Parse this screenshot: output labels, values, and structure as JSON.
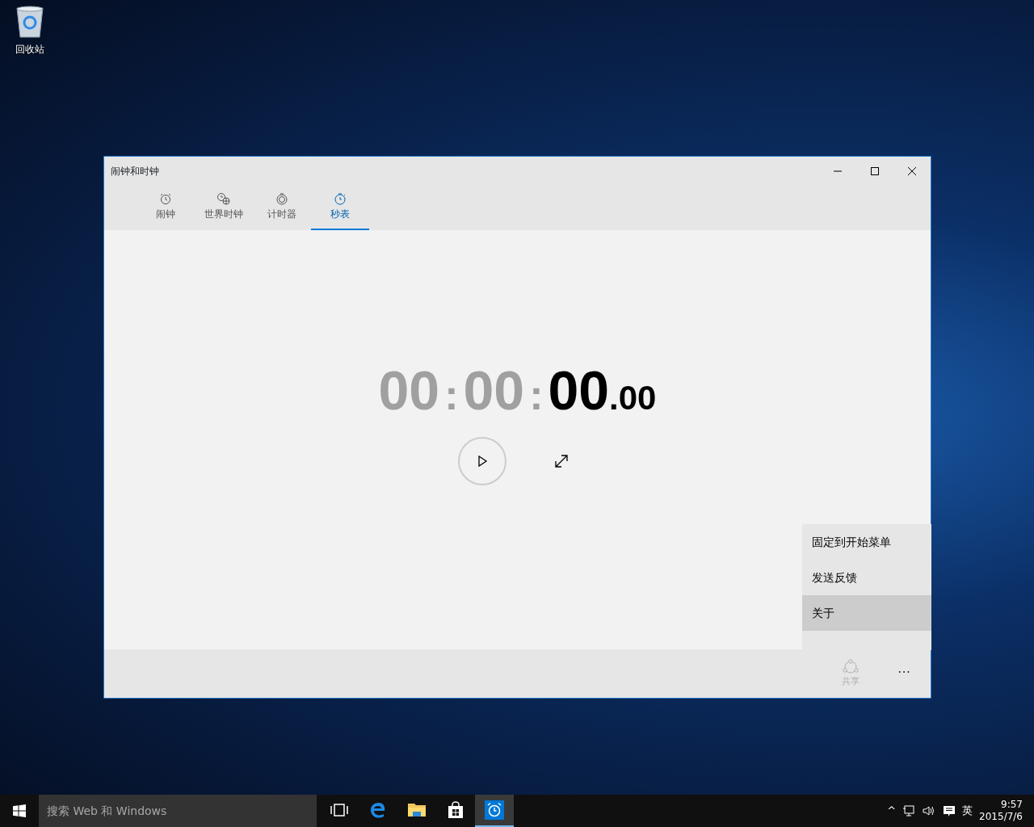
{
  "desktop_icons": [
    {
      "label": "回收站"
    }
  ],
  "window": {
    "title": "闹钟和时钟"
  },
  "tabs": [
    {
      "label": "闹钟",
      "selected": false
    },
    {
      "label": "世界时钟",
      "selected": false
    },
    {
      "label": "计时器",
      "selected": false
    },
    {
      "label": "秒表",
      "selected": true
    }
  ],
  "stopwatch": {
    "segments": [
      {
        "text": "00",
        "kind": "dim"
      },
      {
        "text": ":",
        "kind": "separator"
      },
      {
        "text": "00",
        "kind": "dim"
      },
      {
        "text": ":",
        "kind": "separator"
      },
      {
        "text": "00",
        "kind": "main"
      },
      {
        "text": ".",
        "kind": "fraction"
      },
      {
        "text": "00",
        "kind": "fraction"
      }
    ]
  },
  "menu": {
    "items": [
      {
        "label": "固定到开始菜单",
        "selected": false
      },
      {
        "label": "发送反馈",
        "selected": false
      },
      {
        "label": "关于",
        "selected": true
      }
    ]
  },
  "app_bar": {
    "share": {
      "label": "共享",
      "disabled": true
    },
    "more": "⋯"
  },
  "taskbar": {
    "search": {
      "placeholder": "搜索 Web 和 Windows"
    },
    "apps": [
      {
        "kind": "taskview",
        "selected": false
      },
      {
        "kind": "edge",
        "selected": false
      },
      {
        "kind": "explorer",
        "selected": false
      },
      {
        "kind": "store",
        "selected": false
      },
      {
        "kind": "alarms",
        "selected": true
      }
    ],
    "tray": {
      "chevron": "^",
      "ime": "英",
      "time": "9:57",
      "date": "2015/7/6"
    }
  }
}
